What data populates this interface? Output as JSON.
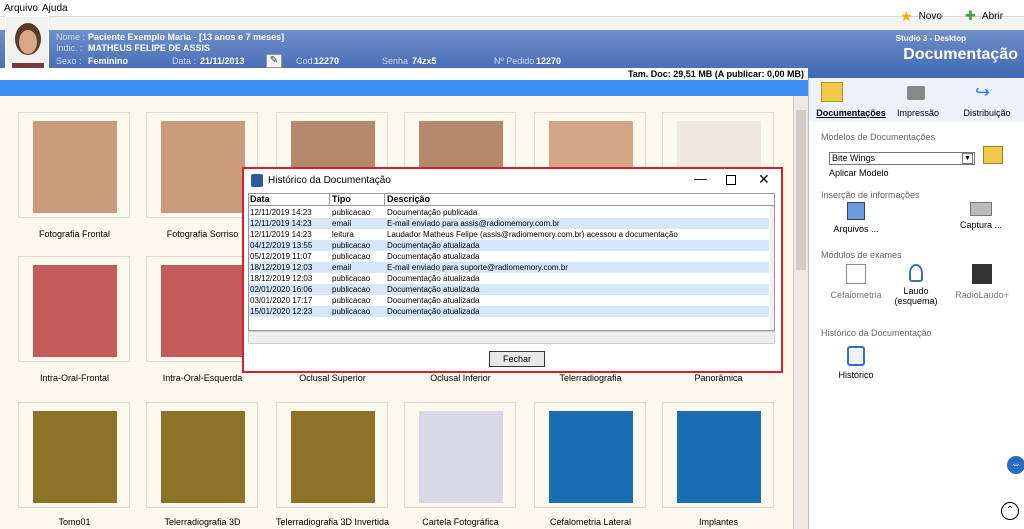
{
  "menu": {
    "arquivo": "Arquivo",
    "ajuda": "Ajuda"
  },
  "toolbar": {
    "novo": "Novo",
    "abrir": "Abrir"
  },
  "patient": {
    "nome_label": "Nome :",
    "nome": "Paciente Exemplo Maria - [13 anos e 7 meses]",
    "indic_label": "Indic. :",
    "indic": "MATHEUS FELIPE DE ASSIS",
    "sexo_label": "Sexo :",
    "sexo": "Feminino",
    "data_label": "Data :",
    "data": "21/11/2013",
    "cod_label": "Cod.",
    "cod": "12270",
    "senha_label": "Senha",
    "senha": "74zx5",
    "pedido_label": "Nº Pedido",
    "pedido": "12270"
  },
  "app": {
    "studio": "Studio 3 - Desktop",
    "section": "Documentação"
  },
  "size_info": "Tam. Doc: 29,51 MB (A publicar: 0,00 MB)",
  "gallery": {
    "items": [
      {
        "label": "Fotografia Frontal"
      },
      {
        "label": "Fotografia Sorriso"
      },
      {
        "label": ""
      },
      {
        "label": ""
      },
      {
        "label": ""
      },
      {
        "label": ""
      },
      {
        "label": "Intra-Oral-Frontal"
      },
      {
        "label": "Intra-Oral-Esquerda"
      },
      {
        "label": "Oclusal Superior"
      },
      {
        "label": "Oclusal Inferior"
      },
      {
        "label": "Telerradiografia"
      },
      {
        "label": "Panorâmica"
      },
      {
        "label": "Tomo01"
      },
      {
        "label": "Telerradiografia 3D"
      },
      {
        "label": "Telerradiografia 3D Invertida"
      },
      {
        "label": "Cartela Fotográfica"
      },
      {
        "label": "Cefalometria Lateral"
      },
      {
        "label": "Implantes"
      }
    ]
  },
  "panel": {
    "tabs": [
      "Documentações",
      "Impressão",
      "Distribuição"
    ],
    "modelos_title": "Modelos de Documentações",
    "model_selected": "Bite Wings",
    "aplicar": "Aplicar Modelo",
    "insercao_title": "Inserção de informações",
    "arquivos": "Arquivos ...",
    "captura": "Captura ...",
    "modulos_title": "Módulos de exames",
    "cefalometria": "Cefalometria",
    "laudo": "Laudo (esquema)",
    "radiolaudo": "RadioLaudo+",
    "historico_title": "Histórico da Documentação",
    "historico": "Histórico"
  },
  "dialog": {
    "title": "Histórico da Documentação",
    "headers": [
      "Data",
      "Tipo",
      "Descrição"
    ],
    "rows": [
      {
        "data": "12/11/2019 14:23",
        "tipo": "publicacao",
        "desc": "Documentação publicada",
        "hl": false
      },
      {
        "data": "12/11/2019 14:23",
        "tipo": "email",
        "desc": "E-mail enviado para assis@radiomemory.com.br",
        "hl": true
      },
      {
        "data": "12/11/2019 14:23",
        "tipo": "leitura",
        "desc": "Laudador Matheus Felipe (assis@radiomemory.com.br) acessou a documentação",
        "hl": false
      },
      {
        "data": "04/12/2019 13:55",
        "tipo": "publicacao",
        "desc": "Documentação atualizada",
        "hl": true
      },
      {
        "data": "05/12/2019 11:07",
        "tipo": "publicacao",
        "desc": "Documentação atualizada",
        "hl": false
      },
      {
        "data": "18/12/2019 12:03",
        "tipo": "email",
        "desc": "E-mail enviado para suporte@radiomemory.com.br",
        "hl": true
      },
      {
        "data": "18/12/2019 12:03",
        "tipo": "publicacao",
        "desc": "Documentação atualizada",
        "hl": false
      },
      {
        "data": "02/01/2020 16:06",
        "tipo": "publicacao",
        "desc": "Documentação atualizada",
        "hl": true
      },
      {
        "data": "03/01/2020 17:17",
        "tipo": "publicacao",
        "desc": "Documentação atualizada",
        "hl": false
      },
      {
        "data": "15/01/2020 12:23",
        "tipo": "publicacao",
        "desc": "Documentação atualizada",
        "hl": true
      }
    ],
    "fechar": "Fechar"
  }
}
